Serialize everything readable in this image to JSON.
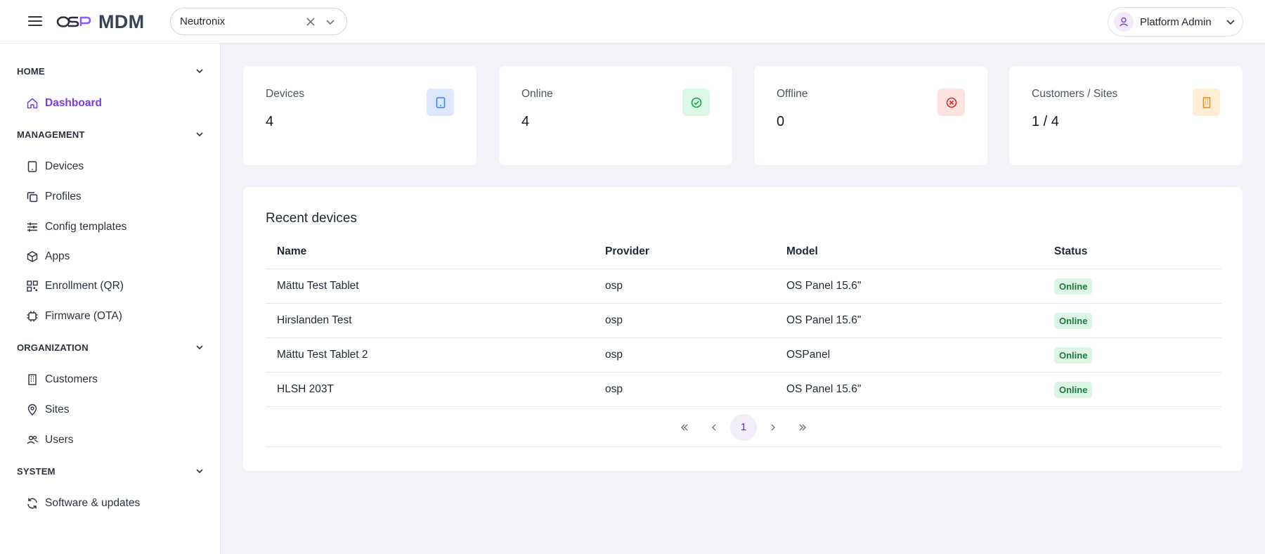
{
  "header": {
    "app_name": "MDM",
    "org_selector": {
      "value": "Neutronix"
    },
    "user": {
      "name": "Platform Admin"
    }
  },
  "sidebar": {
    "sections": [
      {
        "label": "HOME",
        "items": [
          {
            "label": "Dashboard",
            "icon": "home-icon",
            "active": true
          }
        ]
      },
      {
        "label": "MANAGEMENT",
        "items": [
          {
            "label": "Devices",
            "icon": "tablet-icon"
          },
          {
            "label": "Profiles",
            "icon": "copy-icon"
          },
          {
            "label": "Config templates",
            "icon": "sliders-icon"
          },
          {
            "label": "Apps",
            "icon": "package-icon"
          },
          {
            "label": "Enrollment (QR)",
            "icon": "qr-code-icon"
          },
          {
            "label": "Firmware (OTA)",
            "icon": "chip-icon"
          }
        ]
      },
      {
        "label": "ORGANIZATION",
        "items": [
          {
            "label": "Customers",
            "icon": "building-icon"
          },
          {
            "label": "Sites",
            "icon": "map-pin-icon"
          },
          {
            "label": "Users",
            "icon": "users-icon"
          }
        ]
      },
      {
        "label": "SYSTEM",
        "items": [
          {
            "label": "Software & updates",
            "icon": "refresh-icon"
          }
        ]
      }
    ]
  },
  "stats": [
    {
      "label": "Devices",
      "value": "4",
      "icon": "tablet-icon",
      "color": "#3b82f6",
      "bg": "#dbe8fd"
    },
    {
      "label": "Online",
      "value": "4",
      "icon": "check-circle-icon",
      "color": "#16a34a",
      "bg": "#dcf7e6"
    },
    {
      "label": "Offline",
      "value": "0",
      "icon": "x-circle-icon",
      "color": "#dc2626",
      "bg": "#fde2e2"
    },
    {
      "label": "Customers / Sites",
      "value": "1 / 4",
      "icon": "building-icon",
      "color": "#ea8a12",
      "bg": "#feedd5"
    }
  ],
  "recent_devices": {
    "title": "Recent devices",
    "columns": [
      "Name",
      "Provider",
      "Model",
      "Status"
    ],
    "rows": [
      {
        "name": "Mättu Test Tablet",
        "provider": "osp",
        "model": "OS Panel 15.6\"",
        "status": "Online"
      },
      {
        "name": "Hirslanden Test",
        "provider": "osp",
        "model": "OS Panel 15.6\"",
        "status": "Online"
      },
      {
        "name": "Mättu Test Tablet 2",
        "provider": "osp",
        "model": "OSPanel",
        "status": "Online"
      },
      {
        "name": "HLSH 203T",
        "provider": "osp",
        "model": "OS Panel 15.6\"",
        "status": "Online"
      }
    ],
    "pagination": {
      "current_page": "1"
    }
  },
  "colors": {
    "accent": "#7c3aed",
    "online_badge_bg": "#dcf5e4",
    "online_badge_text": "#1e7a3c"
  }
}
